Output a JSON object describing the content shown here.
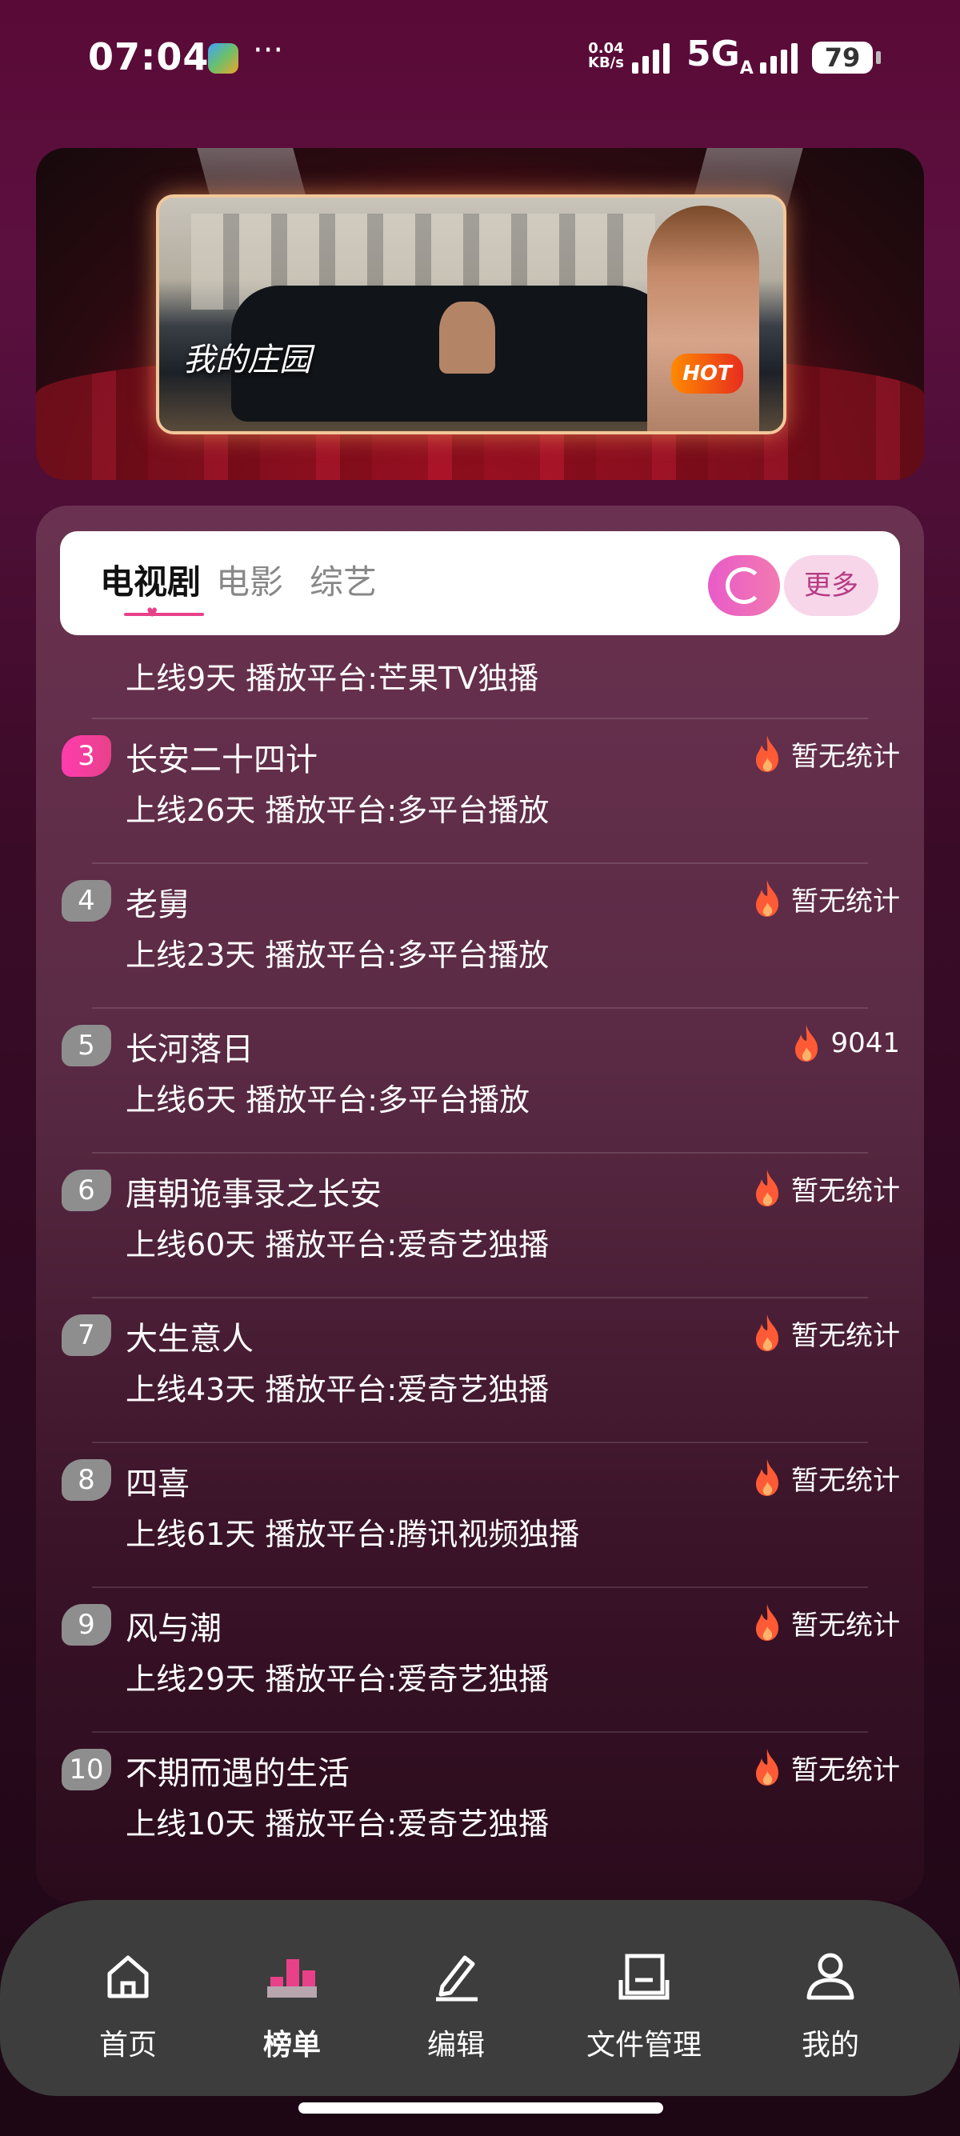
{
  "status": {
    "time": "07:04",
    "net_speed_value": "0.04",
    "net_speed_unit": "KB/s",
    "network": "5G",
    "network_sub": "A",
    "battery": "79"
  },
  "banner": {
    "title": "我的庄园",
    "badge": "HOT"
  },
  "tabs": {
    "items": [
      "电视剧",
      "电影",
      "综艺"
    ],
    "active": "电视剧",
    "more_label": "更多"
  },
  "list": {
    "partial_meta": "上线9天 播放平台:芒果TV独播",
    "items": [
      {
        "rank": "3",
        "title": "长安二十四计",
        "meta": "上线26天 播放平台:多平台播放",
        "hot": "暂无统计"
      },
      {
        "rank": "4",
        "title": "老舅",
        "meta": "上线23天 播放平台:多平台播放",
        "hot": "暂无统计"
      },
      {
        "rank": "5",
        "title": "长河落日",
        "meta": "上线6天 播放平台:多平台播放",
        "hot": "9041"
      },
      {
        "rank": "6",
        "title": "唐朝诡事录之长安",
        "meta": "上线60天 播放平台:爱奇艺独播",
        "hot": "暂无统计"
      },
      {
        "rank": "7",
        "title": "大生意人",
        "meta": "上线43天 播放平台:爱奇艺独播",
        "hot": "暂无统计"
      },
      {
        "rank": "8",
        "title": "四喜",
        "meta": "上线61天 播放平台:腾讯视频独播",
        "hot": "暂无统计"
      },
      {
        "rank": "9",
        "title": "风与潮",
        "meta": "上线29天 播放平台:爱奇艺独播",
        "hot": "暂无统计"
      },
      {
        "rank": "10",
        "title": "不期而遇的生活",
        "meta": "上线10天 播放平台:爱奇艺独播",
        "hot": "暂无统计"
      }
    ]
  },
  "nav": {
    "items": [
      {
        "label": "首页",
        "icon": "home-icon"
      },
      {
        "label": "榜单",
        "icon": "chart-icon"
      },
      {
        "label": "编辑",
        "icon": "edit-icon"
      },
      {
        "label": "文件管理",
        "icon": "folder-icon"
      },
      {
        "label": "我的",
        "icon": "user-icon"
      }
    ],
    "active": "榜单"
  },
  "colors": {
    "accent": "#e8418a",
    "rank_top": "#ff3cae",
    "flame": "#ff5a36"
  }
}
